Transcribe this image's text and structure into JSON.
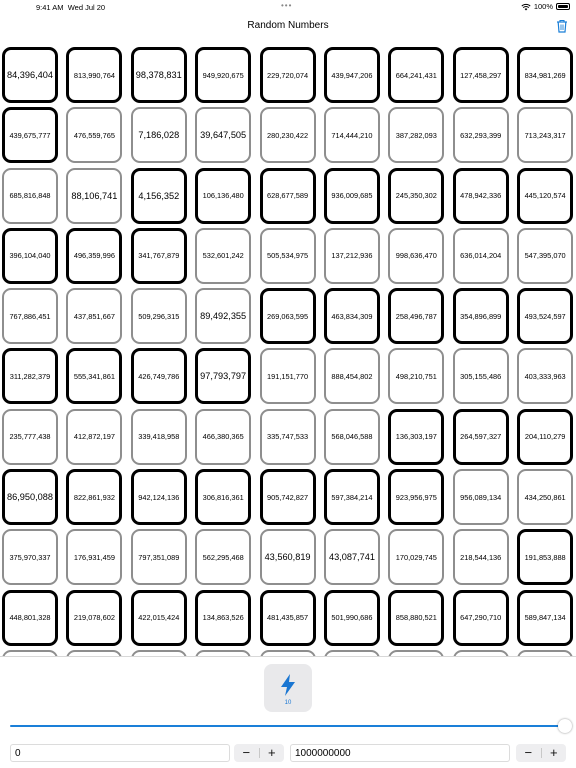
{
  "status_bar": {
    "time": "9:41 AM",
    "date": "Wed Jul 20",
    "battery": "100%"
  },
  "nav": {
    "title": "Random Numbers"
  },
  "cells": [
    {
      "v": "84,396,404",
      "b": 1,
      "l": 1
    },
    {
      "v": "813,990,764",
      "b": 1,
      "l": 0
    },
    {
      "v": "98,378,831",
      "b": 1,
      "l": 1
    },
    {
      "v": "949,920,675",
      "b": 1,
      "l": 0
    },
    {
      "v": "229,720,074",
      "b": 1,
      "l": 0
    },
    {
      "v": "439,947,206",
      "b": 1,
      "l": 0
    },
    {
      "v": "664,241,431",
      "b": 1,
      "l": 0
    },
    {
      "v": "127,458,297",
      "b": 1,
      "l": 0
    },
    {
      "v": "834,981,269",
      "b": 1,
      "l": 0
    },
    {
      "v": "439,675,777",
      "b": 1,
      "l": 0
    },
    {
      "v": "476,559,765",
      "b": 0,
      "l": 0
    },
    {
      "v": "7,186,028",
      "b": 0,
      "l": 1
    },
    {
      "v": "39,647,505",
      "b": 0,
      "l": 1
    },
    {
      "v": "280,230,422",
      "b": 0,
      "l": 0
    },
    {
      "v": "714,444,210",
      "b": 0,
      "l": 0
    },
    {
      "v": "387,282,093",
      "b": 0,
      "l": 0
    },
    {
      "v": "632,293,399",
      "b": 0,
      "l": 0
    },
    {
      "v": "713,243,317",
      "b": 0,
      "l": 0
    },
    {
      "v": "685,816,848",
      "b": 0,
      "l": 0
    },
    {
      "v": "88,106,741",
      "b": 0,
      "l": 1
    },
    {
      "v": "4,156,352",
      "b": 1,
      "l": 1
    },
    {
      "v": "106,136,480",
      "b": 1,
      "l": 0
    },
    {
      "v": "628,677,589",
      "b": 1,
      "l": 0
    },
    {
      "v": "936,009,685",
      "b": 1,
      "l": 0
    },
    {
      "v": "245,350,302",
      "b": 1,
      "l": 0
    },
    {
      "v": "478,942,336",
      "b": 1,
      "l": 0
    },
    {
      "v": "445,120,574",
      "b": 1,
      "l": 0
    },
    {
      "v": "396,104,040",
      "b": 1,
      "l": 0
    },
    {
      "v": "496,359,996",
      "b": 1,
      "l": 0
    },
    {
      "v": "341,767,879",
      "b": 1,
      "l": 0
    },
    {
      "v": "532,601,242",
      "b": 0,
      "l": 0
    },
    {
      "v": "505,534,975",
      "b": 0,
      "l": 0
    },
    {
      "v": "137,212,936",
      "b": 0,
      "l": 0
    },
    {
      "v": "998,636,470",
      "b": 0,
      "l": 0
    },
    {
      "v": "636,014,204",
      "b": 0,
      "l": 0
    },
    {
      "v": "547,395,070",
      "b": 0,
      "l": 0
    },
    {
      "v": "767,886,451",
      "b": 0,
      "l": 0
    },
    {
      "v": "437,851,667",
      "b": 0,
      "l": 0
    },
    {
      "v": "509,296,315",
      "b": 0,
      "l": 0
    },
    {
      "v": "89,492,355",
      "b": 0,
      "l": 1
    },
    {
      "v": "269,063,595",
      "b": 1,
      "l": 0
    },
    {
      "v": "463,834,309",
      "b": 1,
      "l": 0
    },
    {
      "v": "258,496,787",
      "b": 1,
      "l": 0
    },
    {
      "v": "354,896,899",
      "b": 1,
      "l": 0
    },
    {
      "v": "493,524,597",
      "b": 1,
      "l": 0
    },
    {
      "v": "311,282,379",
      "b": 1,
      "l": 0
    },
    {
      "v": "555,341,861",
      "b": 1,
      "l": 0
    },
    {
      "v": "426,749,786",
      "b": 1,
      "l": 0
    },
    {
      "v": "97,793,797",
      "b": 1,
      "l": 1
    },
    {
      "v": "191,151,770",
      "b": 0,
      "l": 0
    },
    {
      "v": "888,454,802",
      "b": 0,
      "l": 0
    },
    {
      "v": "498,210,751",
      "b": 0,
      "l": 0
    },
    {
      "v": "305,155,486",
      "b": 0,
      "l": 0
    },
    {
      "v": "403,333,963",
      "b": 0,
      "l": 0
    },
    {
      "v": "235,777,438",
      "b": 0,
      "l": 0
    },
    {
      "v": "412,872,197",
      "b": 0,
      "l": 0
    },
    {
      "v": "339,418,958",
      "b": 0,
      "l": 0
    },
    {
      "v": "466,380,365",
      "b": 0,
      "l": 0
    },
    {
      "v": "335,747,533",
      "b": 0,
      "l": 0
    },
    {
      "v": "568,046,588",
      "b": 0,
      "l": 0
    },
    {
      "v": "136,303,197",
      "b": 1,
      "l": 0
    },
    {
      "v": "264,597,327",
      "b": 1,
      "l": 0
    },
    {
      "v": "204,110,279",
      "b": 1,
      "l": 0
    },
    {
      "v": "86,950,088",
      "b": 1,
      "l": 1
    },
    {
      "v": "822,861,932",
      "b": 1,
      "l": 0
    },
    {
      "v": "942,124,136",
      "b": 1,
      "l": 0
    },
    {
      "v": "306,816,361",
      "b": 1,
      "l": 0
    },
    {
      "v": "905,742,827",
      "b": 1,
      "l": 0
    },
    {
      "v": "597,384,214",
      "b": 1,
      "l": 0
    },
    {
      "v": "923,956,975",
      "b": 1,
      "l": 0
    },
    {
      "v": "956,089,134",
      "b": 0,
      "l": 0
    },
    {
      "v": "434,250,861",
      "b": 0,
      "l": 0
    },
    {
      "v": "375,970,337",
      "b": 0,
      "l": 0
    },
    {
      "v": "176,931,459",
      "b": 0,
      "l": 0
    },
    {
      "v": "797,351,089",
      "b": 0,
      "l": 0
    },
    {
      "v": "562,295,468",
      "b": 0,
      "l": 0
    },
    {
      "v": "43,560,819",
      "b": 0,
      "l": 1
    },
    {
      "v": "43,087,741",
      "b": 0,
      "l": 1
    },
    {
      "v": "170,029,745",
      "b": 0,
      "l": 0
    },
    {
      "v": "218,544,136",
      "b": 0,
      "l": 0
    },
    {
      "v": "191,853,888",
      "b": 1,
      "l": 0
    },
    {
      "v": "448,801,328",
      "b": 1,
      "l": 0
    },
    {
      "v": "219,078,602",
      "b": 1,
      "l": 0
    },
    {
      "v": "422,015,424",
      "b": 1,
      "l": 0
    },
    {
      "v": "134,863,526",
      "b": 1,
      "l": 0
    },
    {
      "v": "481,435,857",
      "b": 1,
      "l": 0
    },
    {
      "v": "501,990,686",
      "b": 1,
      "l": 0
    },
    {
      "v": "858,880,521",
      "b": 1,
      "l": 0
    },
    {
      "v": "647,290,710",
      "b": 1,
      "l": 0
    },
    {
      "v": "589,847,134",
      "b": 1,
      "l": 0
    },
    {
      "v": "",
      "b": 0,
      "l": 0
    },
    {
      "v": "",
      "b": 0,
      "l": 0
    },
    {
      "v": "",
      "b": 0,
      "l": 0
    },
    {
      "v": "",
      "b": 0,
      "l": 0
    },
    {
      "v": "",
      "b": 0,
      "l": 0
    },
    {
      "v": "",
      "b": 0,
      "l": 0
    },
    {
      "v": "",
      "b": 0,
      "l": 0
    },
    {
      "v": "",
      "b": 0,
      "l": 0
    },
    {
      "v": "",
      "b": 0,
      "l": 0
    }
  ],
  "generate": {
    "count": "10",
    "icon": "bolt-icon",
    "color": "#1976d2"
  },
  "slider": {
    "value_fraction": 1.0
  },
  "range": {
    "min": "0",
    "max": "1000000000"
  },
  "stepper": {
    "minus": "−",
    "plus": "+"
  }
}
